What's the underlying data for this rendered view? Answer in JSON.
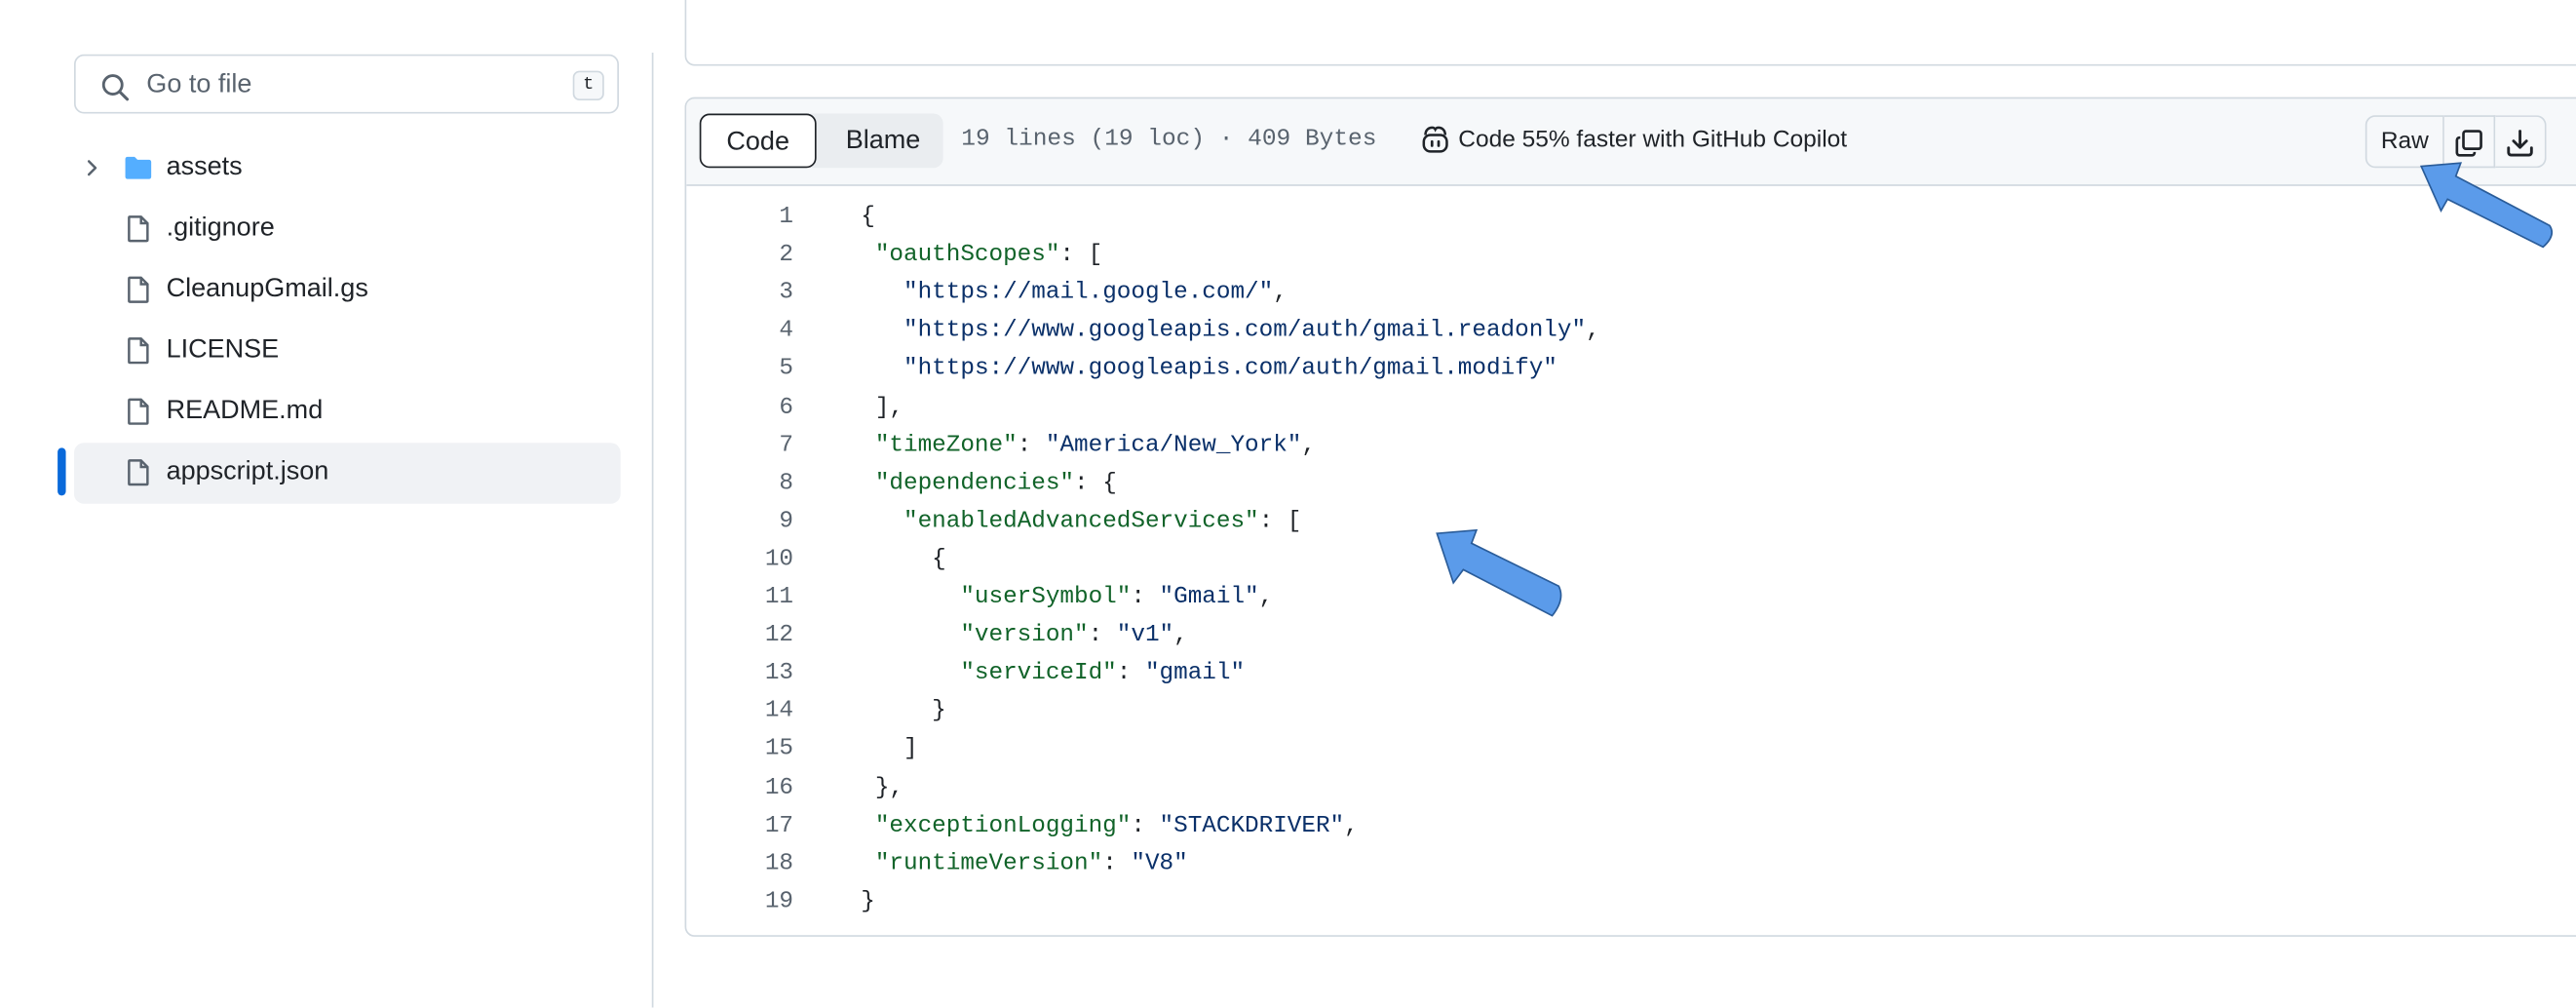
{
  "sidebar": {
    "search": {
      "placeholder": "Go to file",
      "shortcut": "t"
    },
    "items": [
      {
        "label": "assets",
        "type": "folder",
        "icon": "folder-icon"
      },
      {
        "label": ".gitignore",
        "type": "file",
        "icon": "file-icon"
      },
      {
        "label": "CleanupGmail.gs",
        "type": "file",
        "icon": "file-icon"
      },
      {
        "label": "LICENSE",
        "type": "file",
        "icon": "file-icon"
      },
      {
        "label": "README.md",
        "type": "file",
        "icon": "file-icon"
      },
      {
        "label": "appscript.json",
        "type": "file",
        "icon": "file-icon",
        "selected": true
      }
    ]
  },
  "file_header": {
    "tabs": {
      "code": "Code",
      "blame": "Blame"
    },
    "meta": "19 lines (19 loc) · 409 Bytes",
    "copilot": "Code 55% faster with GitHub Copilot",
    "raw_label": "Raw"
  },
  "code_lines": [
    [
      [
        "pun",
        "{"
      ]
    ],
    [
      [
        "pun",
        " "
      ],
      [
        "key",
        "\"oauthScopes\""
      ],
      [
        "pun",
        ": ["
      ]
    ],
    [
      [
        "pun",
        "   "
      ],
      [
        "str",
        "\"https://mail.google.com/\""
      ],
      [
        "pun",
        ","
      ]
    ],
    [
      [
        "pun",
        "   "
      ],
      [
        "str",
        "\"https://www.googleapis.com/auth/gmail.readonly\""
      ],
      [
        "pun",
        ","
      ]
    ],
    [
      [
        "pun",
        "   "
      ],
      [
        "str",
        "\"https://www.googleapis.com/auth/gmail.modify\""
      ]
    ],
    [
      [
        "pun",
        " ],"
      ]
    ],
    [
      [
        "pun",
        " "
      ],
      [
        "key",
        "\"timeZone\""
      ],
      [
        "pun",
        ": "
      ],
      [
        "str",
        "\"America/New_York\""
      ],
      [
        "pun",
        ","
      ]
    ],
    [
      [
        "pun",
        " "
      ],
      [
        "key",
        "\"dependencies\""
      ],
      [
        "pun",
        ": {"
      ]
    ],
    [
      [
        "pun",
        "   "
      ],
      [
        "key",
        "\"enabledAdvancedServices\""
      ],
      [
        "pun",
        ": ["
      ]
    ],
    [
      [
        "pun",
        "     {"
      ]
    ],
    [
      [
        "pun",
        "       "
      ],
      [
        "key",
        "\"userSymbol\""
      ],
      [
        "pun",
        ": "
      ],
      [
        "str",
        "\"Gmail\""
      ],
      [
        "pun",
        ","
      ]
    ],
    [
      [
        "pun",
        "       "
      ],
      [
        "key",
        "\"version\""
      ],
      [
        "pun",
        ": "
      ],
      [
        "str",
        "\"v1\""
      ],
      [
        "pun",
        ","
      ]
    ],
    [
      [
        "pun",
        "       "
      ],
      [
        "key",
        "\"serviceId\""
      ],
      [
        "pun",
        ": "
      ],
      [
        "str",
        "\"gmail\""
      ]
    ],
    [
      [
        "pun",
        "     }"
      ]
    ],
    [
      [
        "pun",
        "   ]"
      ]
    ],
    [
      [
        "pun",
        " },"
      ]
    ],
    [
      [
        "pun",
        " "
      ],
      [
        "key",
        "\"exceptionLogging\""
      ],
      [
        "pun",
        ": "
      ],
      [
        "str",
        "\"STACKDRIVER\""
      ],
      [
        "pun",
        ","
      ]
    ],
    [
      [
        "pun",
        " "
      ],
      [
        "key",
        "\"runtimeVersion\""
      ],
      [
        "pun",
        ": "
      ],
      [
        "str",
        "\"V8\""
      ]
    ],
    [
      [
        "pun",
        "}"
      ]
    ]
  ],
  "colors": {
    "accent": "#0969da",
    "annotation_arrow": "#5b9bea"
  }
}
